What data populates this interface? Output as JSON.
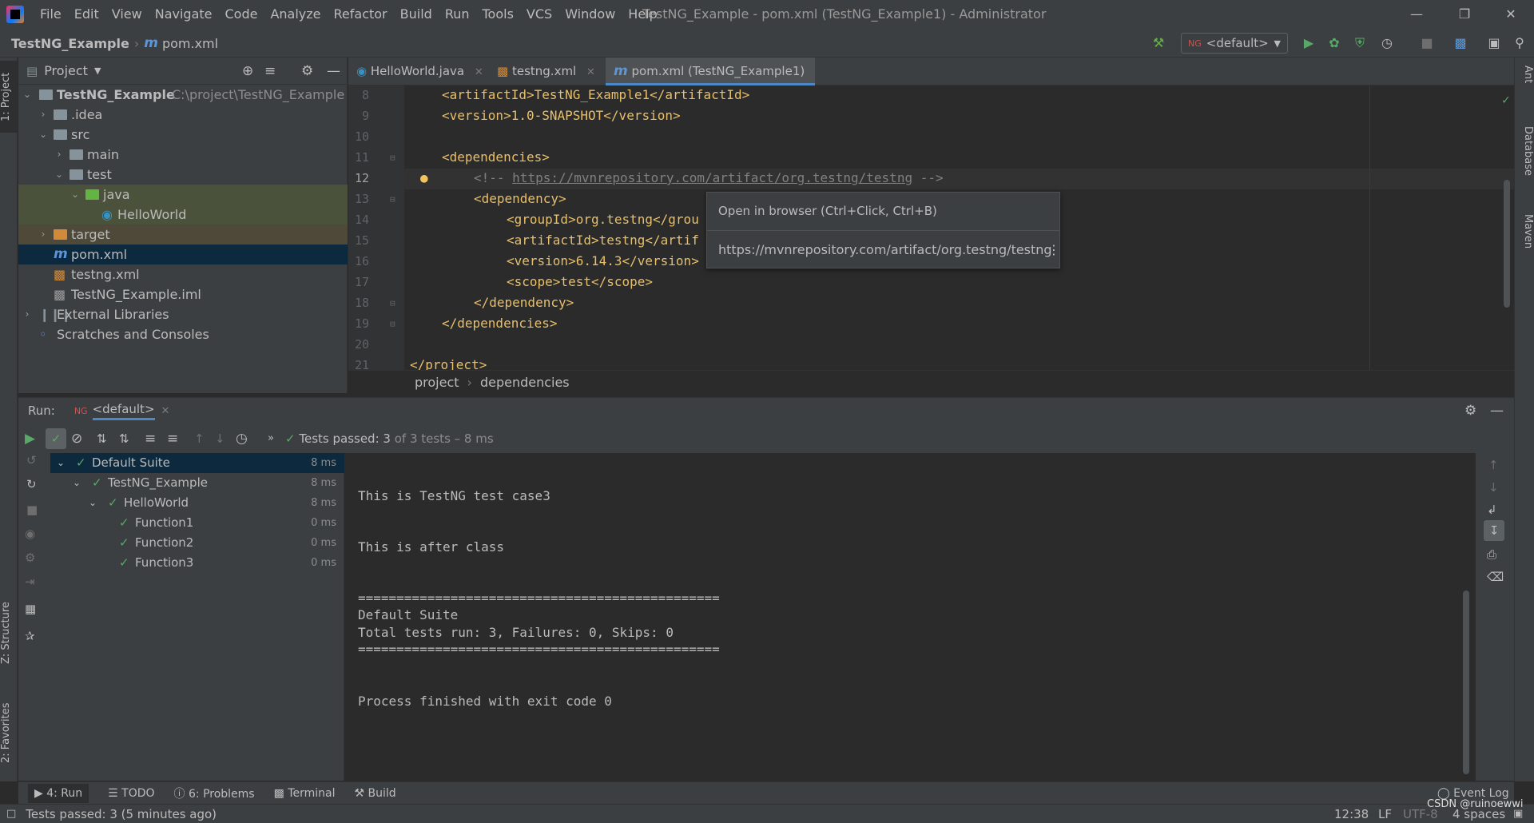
{
  "app": {
    "window_title": "TestNG_Example - pom.xml (TestNG_Example1) - Administrator",
    "menu": [
      "File",
      "Edit",
      "View",
      "Navigate",
      "Code",
      "Analyze",
      "Refactor",
      "Build",
      "Run",
      "Tools",
      "VCS",
      "Window",
      "Help"
    ]
  },
  "navbar": {
    "project": "TestNG_Example",
    "file": "pom.xml",
    "run_config": "<default>"
  },
  "left_strip": {
    "project_tab": "1: Project",
    "structure_tab": "Z: Structure",
    "favorites_tab": "2: Favorites"
  },
  "right_strip": {
    "ant": "Ant",
    "database": "Database",
    "maven": "Maven"
  },
  "project_panel": {
    "title": "Project",
    "tree": [
      {
        "label": "TestNG_Example",
        "extra": "C:\\project\\TestNG_Example"
      },
      {
        "label": ".idea"
      },
      {
        "label": "src"
      },
      {
        "label": "main"
      },
      {
        "label": "test"
      },
      {
        "label": "java"
      },
      {
        "label": "HelloWorld"
      },
      {
        "label": "target"
      },
      {
        "label": "pom.xml"
      },
      {
        "label": "testng.xml"
      },
      {
        "label": "TestNG_Example.iml"
      },
      {
        "label": "External Libraries"
      },
      {
        "label": "Scratches and Consoles"
      }
    ]
  },
  "editor": {
    "tabs": [
      "HelloWorld.java",
      "testng.xml",
      "pom.xml (TestNG_Example1)"
    ],
    "lines": [
      {
        "n": "8",
        "text": "<artifactId>TestNG_Example1</artifactId>"
      },
      {
        "n": "9",
        "text": "<version>1.0-SNAPSHOT</version>"
      },
      {
        "n": "10",
        "text": ""
      },
      {
        "n": "11",
        "text": "<dependencies>"
      },
      {
        "n": "12",
        "pre": "<!-- ",
        "link": "https://mvnrepository.com/artifact/org.testng/testng",
        "post": " -->"
      },
      {
        "n": "13",
        "text": "<dependency>"
      },
      {
        "n": "14",
        "text": "<groupId>org.testng</grou"
      },
      {
        "n": "15",
        "text": "<artifactId>testng</artif"
      },
      {
        "n": "16",
        "text": "<version>6.14.3</version>"
      },
      {
        "n": "17",
        "text": "<scope>test</scope>"
      },
      {
        "n": "18",
        "text": "</dependency>"
      },
      {
        "n": "19",
        "text": "</dependencies>"
      },
      {
        "n": "20",
        "text": ""
      },
      {
        "n": "21",
        "text": "</project>"
      }
    ],
    "popup": {
      "action": "Open in browser (Ctrl+Click, Ctrl+B)",
      "url": "https://mvnrepository.com/artifact/org.testng/testng"
    },
    "breadcrumb": [
      "project",
      "dependencies"
    ]
  },
  "run_panel": {
    "label": "Run:",
    "tab": "<default>",
    "status_prefix": "Tests passed: ",
    "status_count": "3",
    "status_suffix": " of 3 tests – 8 ms",
    "tests": [
      {
        "name": "Default Suite",
        "time": "8 ms"
      },
      {
        "name": "TestNG_Example",
        "time": "8 ms"
      },
      {
        "name": "HelloWorld",
        "time": "8 ms"
      },
      {
        "name": "Function1",
        "time": "0 ms"
      },
      {
        "name": "Function2",
        "time": "0 ms"
      },
      {
        "name": "Function3",
        "time": "0 ms"
      }
    ],
    "console": [
      "This is TestNG test case3",
      "This is after class",
      "===============================================",
      "Default Suite",
      "Total tests run: 3, Failures: 0, Skips: 0",
      "===============================================",
      "Process finished with exit code 0"
    ]
  },
  "toolwindows": [
    {
      "label": "4: Run"
    },
    {
      "label": "TODO"
    },
    {
      "label": "6: Problems"
    },
    {
      "label": "Terminal"
    },
    {
      "label": "Build"
    }
  ],
  "event_log": "Event Log",
  "statusbar": {
    "message": "Tests passed: 3 (5 minutes ago)",
    "position": "12:38",
    "line_sep": "LF",
    "encoding": "UTF-8",
    "indent": "4 spaces",
    "watermark": "CSDN @ruinoewwi"
  }
}
